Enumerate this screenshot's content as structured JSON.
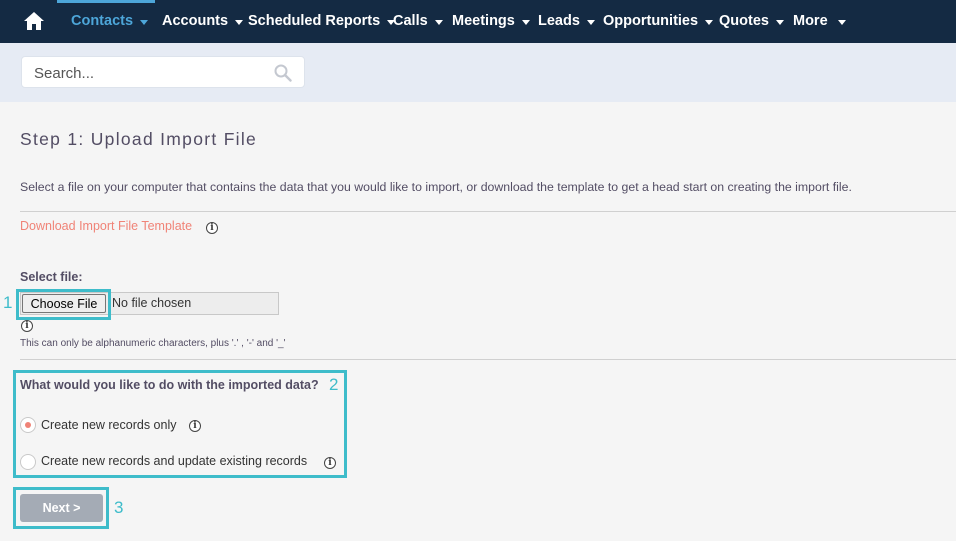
{
  "nav": {
    "items": [
      {
        "label": "Contacts",
        "active": true
      },
      {
        "label": "Accounts"
      },
      {
        "label": "Scheduled Reports"
      },
      {
        "label": "Calls"
      },
      {
        "label": "Meetings"
      },
      {
        "label": "Leads"
      },
      {
        "label": "Opportunities"
      },
      {
        "label": "Quotes"
      },
      {
        "label": "More"
      }
    ],
    "home_icon": "home-icon",
    "active_color": "#4da6d9",
    "bar_color": "#142a43"
  },
  "search": {
    "placeholder": "Search...",
    "icon": "search-icon"
  },
  "step": {
    "title": "Step 1: Upload Import File",
    "intro": "Select a file on your computer that contains the data that you would like to import, or download the template to get a head start on creating the import file.",
    "download_link": "Download Import File Template",
    "info_glyph": "i"
  },
  "file": {
    "label": "Select file:",
    "button_label": "Choose File",
    "status": "No file chosen",
    "hint": "This can only be alphanumeric characters, plus '.' , '-' and '_'"
  },
  "import_options": {
    "question": "What would you like to do with the imported data?",
    "options": [
      {
        "label": "Create new records only",
        "selected": true
      },
      {
        "label": "Create new records and update existing records",
        "selected": false
      }
    ]
  },
  "actions": {
    "next_label": "Next >"
  },
  "callouts": [
    "1",
    "2",
    "3"
  ],
  "colors": {
    "link": "#f08377",
    "callout": "#3ebcca",
    "next_button": "#a4abb5"
  }
}
